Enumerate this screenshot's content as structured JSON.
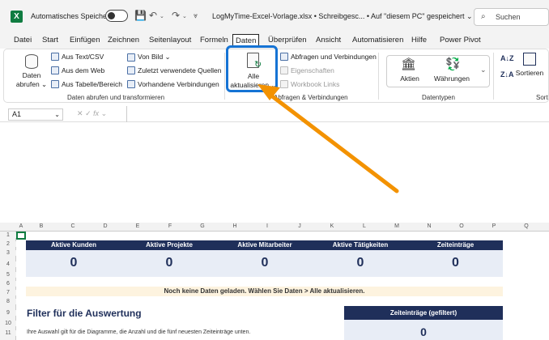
{
  "titlebar": {
    "autosave_label": "Automatisches Speichern",
    "doc_title": "LogMyTime-Excel-Vorlage.xlsx  •  Schreibgesc...  •  Auf \"diesem PC\" gespeichert ⌄",
    "search_placeholder": "Suchen"
  },
  "tabs": [
    "Datei",
    "Start",
    "Einfügen",
    "Zeichnen",
    "Seitenlayout",
    "Formeln",
    "Daten",
    "Überprüfen",
    "Ansicht",
    "Automatisieren",
    "Hilfe",
    "Power Pivot"
  ],
  "active_tab": "Daten",
  "ribbon": {
    "get_data": {
      "data_btn_line1": "Daten",
      "data_btn_line2": "abrufen ⌄",
      "text_csv": "Aus Text/CSV",
      "from_web": "Aus dem Web",
      "from_table": "Aus Tabelle/Bereich",
      "from_picture": "Von Bild ⌄",
      "recent_sources": "Zuletzt verwendete Quellen",
      "existing_connections": "Vorhandene Verbindungen",
      "group_label": "Daten abrufen und transformieren"
    },
    "queries": {
      "refresh_line1": "Alle",
      "refresh_line2": "aktualisieren ⌄",
      "queries_connections": "Abfragen und Verbindungen",
      "properties": "Eigenschaften",
      "workbook_links": "Workbook Links",
      "group_label": "Abfragen & Verbindungen"
    },
    "datatypes": {
      "stocks": "Aktien",
      "currencies": "Währungen",
      "group_label": "Datentypen"
    },
    "sort": {
      "sort_label": "Sortieren",
      "group_label": "Sort"
    }
  },
  "formula_bar": {
    "name_box": "A1",
    "fx": "fx"
  },
  "columns": [
    "A",
    "B",
    "C",
    "D",
    "E",
    "F",
    "G",
    "H",
    "I",
    "J",
    "K",
    "L",
    "M",
    "N",
    "O",
    "P",
    "Q"
  ],
  "rows": [
    "1",
    "2",
    "3",
    "4",
    "5",
    "6",
    "7",
    "8",
    "9",
    "10",
    "11"
  ],
  "kpis": [
    {
      "label": "Aktive Kunden",
      "value": "0"
    },
    {
      "label": "Aktive Projekte",
      "value": "0"
    },
    {
      "label": "Aktive Mitarbeiter",
      "value": "0"
    },
    {
      "label": "Aktive Tätigkeiten",
      "value": "0"
    },
    {
      "label": "Zeiteinträge",
      "value": "0"
    }
  ],
  "notice": "Noch keine Daten geladen. Wählen Sie Daten > Alle aktualisieren.",
  "filter": {
    "title": "Filter für die Auswertung",
    "description": "Ihre Auswahl gilt für die Diagramme, die Anzahl und die fünf neuesten Zeiteinträge unten."
  },
  "filtered_entries": {
    "label": "Zeiteinträge (gefiltert)",
    "value": "0"
  },
  "colors": {
    "accent_dark": "#1f2f5a",
    "highlight": "#1573d4",
    "arrow": "#f39200",
    "excel_green": "#107c41"
  }
}
